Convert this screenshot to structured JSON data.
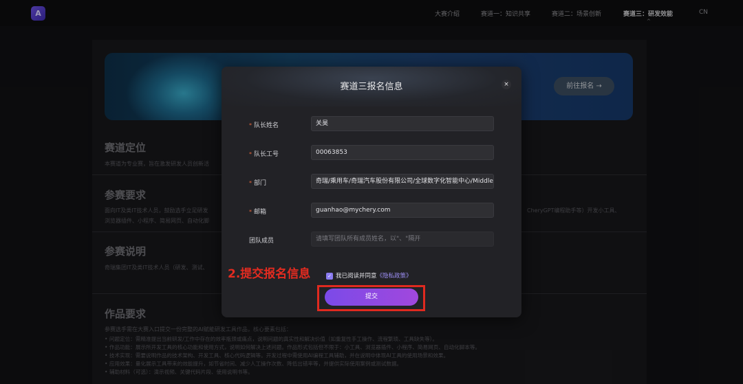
{
  "nav": {
    "logo": "A",
    "items": [
      "大赛介绍",
      "赛道一：知识共享",
      "赛道二：场景创新",
      "赛道三：研发效能",
      "CN"
    ],
    "active_caret": "^"
  },
  "hero": {
    "button_label": "前往报名 →"
  },
  "sections": {
    "positioning": {
      "title": "赛道定位",
      "text": "本赛道为专业赛，旨在激发研发人员创新活"
    },
    "requirements": {
      "title": "参赛要求",
      "text1": "面向IT及类IT技术人员，鼓励选手立足研发",
      "text1_right": "CheryGPT编程助手等）开发小工具、",
      "text2": "浏览器插件、小程序、简易网页、自动化脚"
    },
    "instructions": {
      "title": "参赛说明",
      "text": "奇瑞集团IT及类IT技术人员（研发、测试、"
    },
    "works": {
      "title": "作品要求",
      "intro": "参赛选手需在大赛入口提交一份完整的AI赋能研发工具作品，核心要素包括：",
      "items": [
        "• 问题定位：需精准提出当前研发/工作中存在的效率瓶颈或痛点，说明问题的真实性和解决价值（如重复性手工操作、流程繁琐、工具缺失等）。",
        "• 作品功能：展示所开发工具的核心功能和使用方式，说明如何解决上述问题。作品形式包括但不限于：小工具、浏览器插件、小程序、简易网页、自动化脚本等。",
        "• 技术实现：需要说明作品的技术架构、开发工具、核心代码逻辑等。开发过程中需使用AI编程工具辅助，并在说明中体现AI工具的使用场景和效果。",
        "• 应用效果：量化展示工具带来的效能提升，如节省时间、减少人工操作次数、降低出错率等，并提供实际使用案例或测试数据。",
        "• 辅助材料（可选）：演示视频、关键代码片段、使用说明书等。"
      ]
    }
  },
  "modal": {
    "title": "赛道三报名信息",
    "close": "×",
    "fields": [
      {
        "label": "队长姓名",
        "required": true,
        "value": "关昊"
      },
      {
        "label": "队长工号",
        "required": true,
        "value": "00063853"
      },
      {
        "label": "部门",
        "required": true,
        "value": "奇瑞/乘用车/奇瑞汽车股份有限公司/全球数字化智能中心/Middle"
      },
      {
        "label": "邮箱",
        "required": true,
        "value": "guanhao@mychery.com"
      },
      {
        "label": "团队成员",
        "required": false,
        "placeholder": "请填写团队所有成员姓名，以\"、\"隔开"
      }
    ],
    "required_mark": "*",
    "agree_prefix": "我已阅读并同意",
    "agree_link": "《隐私政策》",
    "checkbox_mark": "✓",
    "submit_label": "提交"
  },
  "annotation": {
    "text": "2.提交报名信息",
    "color": "#e32b20"
  }
}
